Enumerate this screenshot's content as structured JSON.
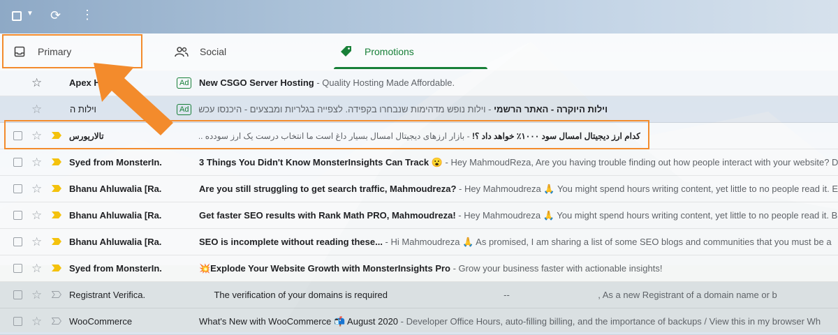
{
  "tabs": {
    "primary": "Primary",
    "social": "Social",
    "promotions": "Promotions"
  },
  "emails": [
    {
      "sender": "Apex Ho",
      "ad": "Ad",
      "subject": "New CSGO Server Hosting",
      "snippet": " - Quality Hosting Made Affordable.",
      "read": false
    },
    {
      "sender": "וילות ה",
      "ad": "Ad",
      "subject": "וילות היוקרה - האתר הרשמי",
      "snippet": " - וילות נופש מדהימות שנבחרו בקפידה. לצפייה בגלריות ומבצעים - היכנסו עכשיו!",
      "read": true,
      "rtl": true
    },
    {
      "sender": "تالاریورس",
      "subject": "كدام ارز ديجيتال امسال سود ۱۰۰۰٪ خواهد داد ؟!",
      "snippet": " - بازار ارزهای دیجیتال امسال بسیار داغ است ما انتخاب درست یک ارز سودده .....",
      "read": false,
      "rtl": true
    },
    {
      "sender": "Syed from MonsterIn.",
      "subject": "3 Things You Didn't Know MonsterInsights Can Track 😮",
      "snippet": " - Hey MahmoudReza, Are you having trouble finding out how people interact with your website? Do",
      "read": false
    },
    {
      "sender": "Bhanu Ahluwalia [Ra.",
      "subject": "Are you still struggling to get search traffic, Mahmoudreza?",
      "snippet": " - Hey Mahmoudreza 🙏 You might spend hours writing content, yet little to no people read it. E",
      "read": false
    },
    {
      "sender": "Bhanu Ahluwalia [Ra.",
      "subject": "Get faster SEO results with Rank Math PRO, Mahmoudreza!",
      "snippet": " - Hey Mahmoudreza 🙏 You might spend hours writing content, yet little to no people read it. B",
      "read": false
    },
    {
      "sender": "Bhanu Ahluwalia [Ra.",
      "subject": "SEO is incomplete without reading these...",
      "snippet": " - Hi Mahmoudreza 🙏 As promised, I am sharing a list of some SEO blogs and communities that you must be a",
      "read": false
    },
    {
      "sender": "Syed from MonsterIn.",
      "subject": "💥Explode Your Website Growth with MonsterInsights Pro",
      "snippet": " - Grow your business faster with actionable insights!",
      "read": false
    },
    {
      "sender": "Registrant Verifica.",
      "subject": "The verification of your domains is required",
      "snippet": "                                              --                                   , As a new Registrant of a domain name or b",
      "read": true
    },
    {
      "sender": "WooCommerce",
      "subject": "What's New with WooCommerce 📬 August 2020",
      "snippet": " - Developer Office Hours, auto-filling billing, and the importance of backups / View this in my browser Wh",
      "read": true
    }
  ],
  "colors": {
    "accent": "#188038",
    "highlight": "#f38b2c",
    "important": "#f4c20d"
  }
}
